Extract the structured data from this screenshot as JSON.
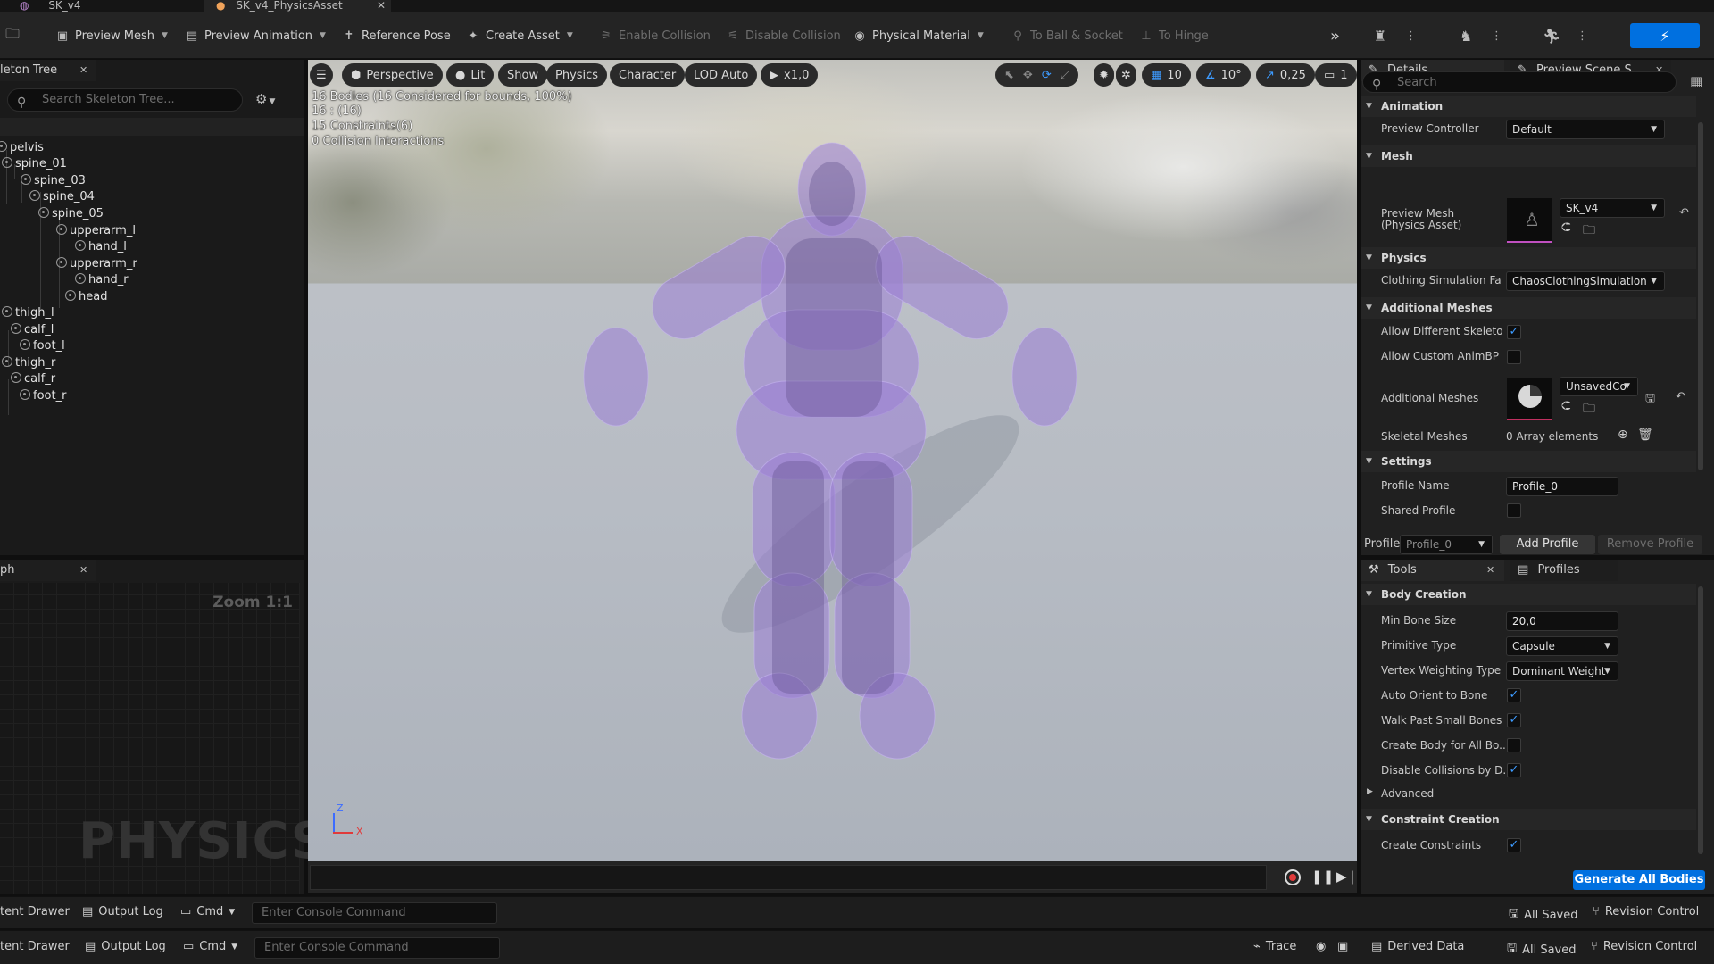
{
  "tabs": [
    {
      "label": "SK_v4"
    },
    {
      "label": "SK_v4_PhysicsAsset"
    }
  ],
  "toolbar": {
    "preview_mesh": "Preview Mesh",
    "preview_animation": "Preview Animation",
    "reference_pose": "Reference Pose",
    "create_asset": "Create Asset",
    "enable_collision": "Enable Collision",
    "disable_collision": "Disable Collision",
    "physical_material": "Physical Material",
    "to_ball_socket": "To Ball & Socket",
    "to_hinge": "To Hinge"
  },
  "skeleton_tree": {
    "tab_label": "leton Tree",
    "search_placeholder": "Search Skeleton Tree...",
    "bones": [
      "pelvis",
      "spine_01",
      "spine_03",
      "spine_04",
      "spine_05",
      "upperarm_l",
      "hand_l",
      "upperarm_r",
      "hand_r",
      "head",
      "thigh_l",
      "calf_l",
      "foot_l",
      "thigh_r",
      "calf_r",
      "foot_r"
    ]
  },
  "graph": {
    "tab_label": "ph",
    "zoom": "Zoom 1:1",
    "watermark": "PHYSICS"
  },
  "viewport": {
    "perspective": "Perspective",
    "lit": "Lit",
    "show": "Show",
    "physics": "Physics",
    "character": "Character",
    "lod": "LOD Auto",
    "speed": "x1,0",
    "grid_snap": "10",
    "rot_snap": "10°",
    "scale_snap": "0,25",
    "camera_speed": "1",
    "info_bodies": "16 Bodies (16 Considered for bounds, 100%)",
    "info_count": "16 : (16)",
    "info_constraints": "15 Constraints(6)",
    "info_collisions": "0 Collision Interactions",
    "axis_z": "Z",
    "axis_x": "X"
  },
  "details": {
    "tab_label": "Details",
    "preview_tab_label": "Preview Scene S...",
    "search_placeholder": "Search",
    "sections": {
      "animation": "Animation",
      "mesh": "Mesh",
      "physics": "Physics",
      "additional_meshes": "Additional Meshes",
      "settings": "Settings"
    },
    "preview_controller_label": "Preview Controller",
    "preview_controller_value": "Default",
    "preview_mesh_label_1": "Preview Mesh",
    "preview_mesh_label_2": "(Physics Asset)",
    "preview_mesh_value": "SK_v4",
    "clothing_label": "Clothing Simulation Fact",
    "clothing_value": "ChaosClothingSimulation",
    "allow_diff_skel_label": "Allow Different Skeleton",
    "allow_custom_animbp_label": "Allow Custom AnimBP O",
    "additional_meshes_label": "Additional Meshes",
    "additional_meshes_value": "UnsavedCo",
    "skeletal_meshes_label": "Skeletal Meshes",
    "skeletal_meshes_value": "0 Array elements",
    "profile_name_label": "Profile Name",
    "profile_name_value": "Profile_0",
    "shared_profile_label": "Shared Profile",
    "profile_label": "Profile",
    "profile_value": "Profile_0",
    "add_profile": "Add Profile",
    "remove_profile": "Remove Profile"
  },
  "tools": {
    "tab_label": "Tools",
    "profiles_tab": "Profiles",
    "body_creation": "Body Creation",
    "min_bone_size_label": "Min Bone Size",
    "min_bone_size_value": "20,0",
    "primitive_type_label": "Primitive Type",
    "primitive_type_value": "Capsule",
    "vertex_weighting_label": "Vertex Weighting Type",
    "vertex_weighting_value": "Dominant Weight",
    "auto_orient_label": "Auto Orient to Bone",
    "walk_past_label": "Walk Past Small Bones",
    "create_body_label": "Create Body for All Bo...",
    "disable_collisions_label": "Disable Collisions by D...",
    "advanced": "Advanced",
    "constraint_creation": "Constraint Creation",
    "create_constraints_label": "Create Constraints",
    "generate_button": "Generate All Bodies"
  },
  "statusbar": {
    "content_drawer": "tent Drawer",
    "output_log": "Output Log",
    "cmd": "Cmd",
    "console_placeholder": "Enter Console Command",
    "all_saved": "All Saved",
    "revision_control": "Revision Control",
    "trace": "Trace",
    "derived_data": "Derived Data"
  },
  "colors": {
    "accent": "#0070e0",
    "physics_body": "#9a7ed6",
    "check": "#3d9bff"
  }
}
